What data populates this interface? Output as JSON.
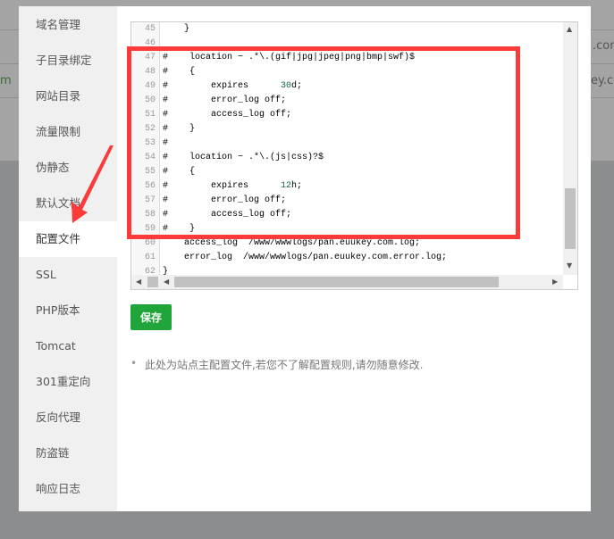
{
  "background": {
    "row_texts": [
      ".com",
      "m",
      "ey.com"
    ]
  },
  "sidebar": {
    "items": [
      {
        "label": "域名管理"
      },
      {
        "label": "子目录绑定"
      },
      {
        "label": "网站目录"
      },
      {
        "label": "流量限制"
      },
      {
        "label": "伪静态"
      },
      {
        "label": "默认文档"
      },
      {
        "label": "配置文件",
        "active": true
      },
      {
        "label": "SSL"
      },
      {
        "label": "PHP版本"
      },
      {
        "label": "Tomcat"
      },
      {
        "label": "301重定向"
      },
      {
        "label": "反向代理"
      },
      {
        "label": "防盗链"
      },
      {
        "label": "响应日志"
      }
    ]
  },
  "editor": {
    "lines": [
      {
        "n": "45",
        "t": "    }"
      },
      {
        "n": "46",
        "t": ""
      },
      {
        "n": "47",
        "t": "#    location ~ .*\\.(gif|jpg|jpeg|png|bmp|swf)$"
      },
      {
        "n": "48",
        "t": "#    {"
      },
      {
        "n": "49",
        "t": "#        expires      30d;"
      },
      {
        "n": "50",
        "t": "#        error_log off;"
      },
      {
        "n": "51",
        "t": "#        access_log off;"
      },
      {
        "n": "52",
        "t": "#    }"
      },
      {
        "n": "53",
        "t": "#"
      },
      {
        "n": "54",
        "t": "#    location ~ .*\\.(js|css)?$"
      },
      {
        "n": "55",
        "t": "#    {"
      },
      {
        "n": "56",
        "t": "#        expires      12h;"
      },
      {
        "n": "57",
        "t": "#        error_log off;"
      },
      {
        "n": "58",
        "t": "#        access_log off;"
      },
      {
        "n": "59",
        "t": "#    }"
      },
      {
        "n": "60",
        "t": "    access_log  /www/wwwlogs/pan.euukey.com.log;"
      },
      {
        "n": "61",
        "t": "    error_log  /www/wwwlogs/pan.euukey.com.error.log;"
      },
      {
        "n": "62",
        "t": "}"
      }
    ]
  },
  "save_label": "保存",
  "tip": "此处为站点主配置文件,若您不了解配置规则,请勿随意修改.",
  "colors": {
    "accent": "#20a53a",
    "annotation": "#fb3a3a",
    "number": "#116644"
  }
}
